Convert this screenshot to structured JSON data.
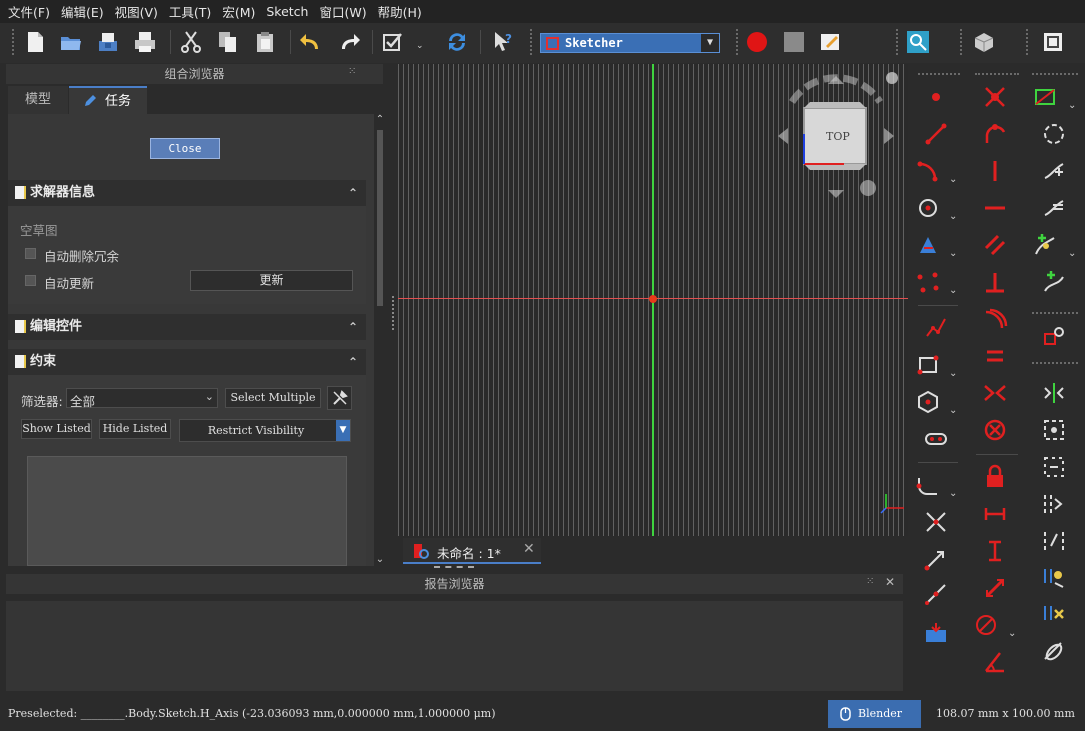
{
  "menu": [
    "文件(F)",
    "编辑(E)",
    "视图(V)",
    "工具(T)",
    "宏(M)",
    "Sketch",
    "窗口(W)",
    "帮助(H)"
  ],
  "toolbar": {
    "workbench": "Sketcher"
  },
  "combo_view": {
    "title": "组合浏览器",
    "tabs": [
      "模型",
      "任务"
    ],
    "close_label": "Close",
    "solver": {
      "title": "求解器信息",
      "status": "空草图",
      "auto_remove_label": "自动删除冗余",
      "auto_update_label": "自动更新",
      "update_label": "更新"
    },
    "edit_controls": {
      "title": "编辑控件"
    },
    "constraints": {
      "title": "约束",
      "filter_label": "筛选器:",
      "filter_value": "全部",
      "select_multiple": "Select Multiple",
      "show_listed": "Show Listed",
      "hide_listed": "Hide Listed",
      "restrict_visibility": "Restrict Visibility"
    }
  },
  "viewport": {
    "navcube_face": "TOP",
    "tab_label": "未命名 : 1*"
  },
  "report_view": {
    "title": "报告浏览器"
  },
  "status": {
    "preselected": "Preselected: ________.Body.Sketch.H_Axis (-23.036093 mm,0.000000 mm,1.000000 μm)",
    "nav_style": "Blender",
    "dimensions": "108.07 mm x 100.00 mm"
  },
  "colors": {
    "accent": "#4a7ec8",
    "sketch_red": "#e02020",
    "axis_green": "#3fd43f",
    "axis_red": "#e05050"
  }
}
